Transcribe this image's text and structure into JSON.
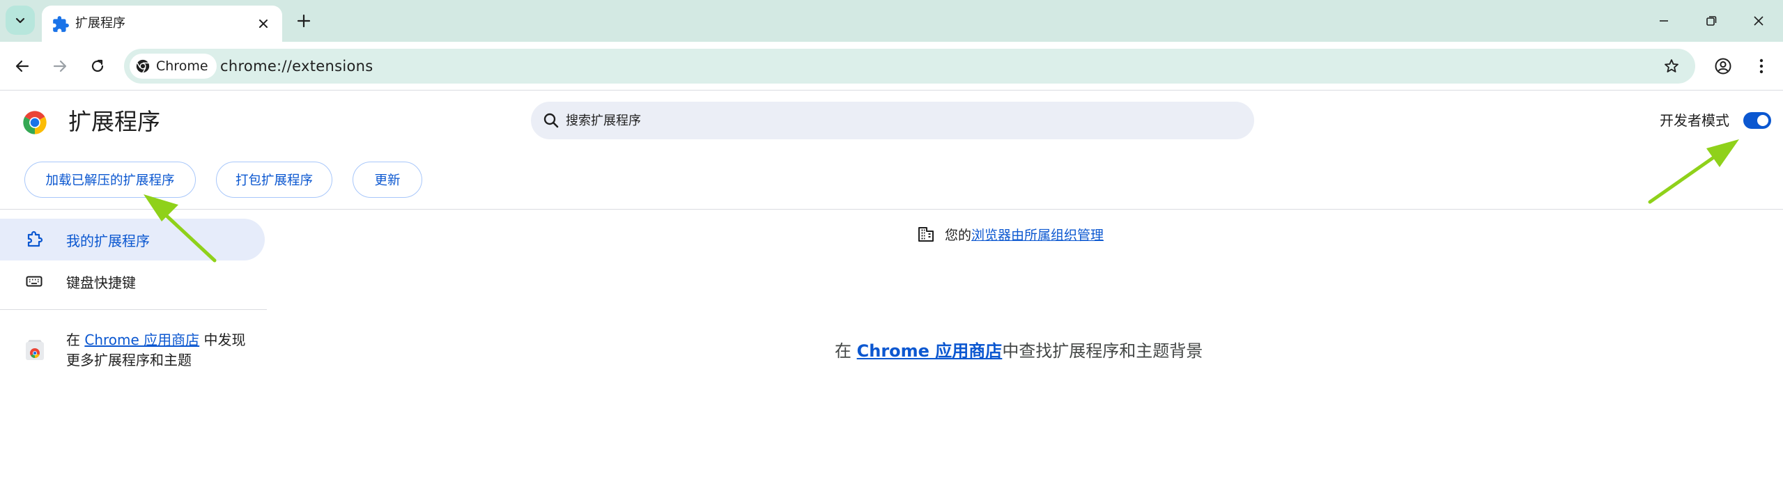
{
  "browser": {
    "tab": {
      "title": "扩展程序",
      "favicon": "puzzle-icon"
    },
    "omnibox": {
      "site_chip": "Chrome",
      "url": "chrome://extensions"
    }
  },
  "header": {
    "title": "扩展程序",
    "search_placeholder": "搜索扩展程序",
    "developer_mode_label": "开发者模式",
    "developer_mode_on": true
  },
  "actions": {
    "load_unpacked": "加载已解压的扩展程序",
    "pack": "打包扩展程序",
    "update": "更新"
  },
  "sidebar": {
    "items": [
      {
        "label": "我的扩展程序",
        "icon": "extension-icon",
        "selected": true
      },
      {
        "label": "键盘快捷键",
        "icon": "keyboard-icon",
        "selected": false
      }
    ],
    "store_prefix": "在 ",
    "store_link": "Chrome 应用商店",
    "store_suffix": " 中发现更多扩展程序和主题"
  },
  "main": {
    "managed_prefix": "您的",
    "managed_link": "浏览器由所属组织管理",
    "empty_prefix": "在 ",
    "empty_link": "Chrome 应用商店",
    "empty_suffix": "中查找扩展程序和主题背景"
  },
  "colors": {
    "accent": "#0b57d0",
    "tabstrip": "#d3e9e3",
    "omnibox": "#dcefea",
    "arrow": "#8fd11a"
  }
}
